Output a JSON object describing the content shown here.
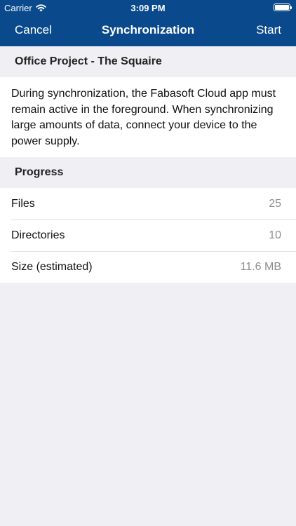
{
  "status_bar": {
    "carrier": "Carrier",
    "time": "3:09 PM"
  },
  "nav": {
    "cancel_label": "Cancel",
    "title": "Synchronization",
    "start_label": "Start"
  },
  "project": {
    "name": "Office Project - The Squaire"
  },
  "info": {
    "text": "During synchronization, the Fabasoft Cloud app must remain active in the foreground. When synchronizing large amounts of data, connect your device to the power supply."
  },
  "progress": {
    "header": "Progress",
    "rows": [
      {
        "label": "Files",
        "value": "25"
      },
      {
        "label": "Directories",
        "value": "10"
      },
      {
        "label": "Size (estimated)",
        "value": "11.6 MB"
      }
    ]
  },
  "colors": {
    "header_bg": "#0a4a8c",
    "background": "#efeff4",
    "value_gray": "#8e8e93"
  }
}
